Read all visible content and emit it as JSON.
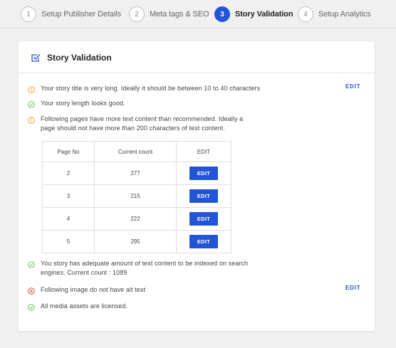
{
  "stepper": {
    "steps": [
      {
        "num": "1",
        "label": "Setup Publisher Details"
      },
      {
        "num": "2",
        "label": "Meta tags & SEO"
      },
      {
        "num": "3",
        "label": "Story Validation"
      },
      {
        "num": "4",
        "label": "Setup Analytics"
      }
    ],
    "active_step": 3
  },
  "card": {
    "title": "Story Validation",
    "header_icon": "checkbox-icon"
  },
  "validation": {
    "items": [
      {
        "status": "warning",
        "icon": "warning-icon",
        "text": "Your story title is very long. Ideally it should be between 10 to 40 characters"
      },
      {
        "status": "pass",
        "icon": "check-icon",
        "text": "Your story length looks good."
      },
      {
        "status": "warning",
        "icon": "warning-icon",
        "text_line1": "Following pages have more text content than recommended. Ideally a",
        "text_line2": "page should not have more than 200 characters of text content."
      },
      {
        "status": "pass",
        "icon": "check-icon",
        "text_line1": "You story has adequate amount of text content to be indexed on search",
        "text_line2": "engines. Current count : 1089"
      },
      {
        "status": "error",
        "icon": "error-icon",
        "text": "Following image do not have alt text"
      },
      {
        "status": "pass",
        "icon": "check-icon",
        "text": "All media assets are licensed."
      }
    ],
    "edit_label": "EDIT"
  },
  "pages_table": {
    "headers": [
      "Page No",
      "Current count",
      "EDIT"
    ],
    "rows": [
      {
        "page": "2",
        "count": "277",
        "action": "EDIT"
      },
      {
        "page": "3",
        "count": "215",
        "action": "EDIT"
      },
      {
        "page": "4",
        "count": "222",
        "action": "EDIT"
      },
      {
        "page": "5",
        "count": "295",
        "action": "EDIT"
      }
    ]
  },
  "colors": {
    "accent": "#2255d6",
    "warning": "#f0a030",
    "pass": "#5fc45f",
    "error": "#e04545",
    "background": "#f0f0f0"
  }
}
